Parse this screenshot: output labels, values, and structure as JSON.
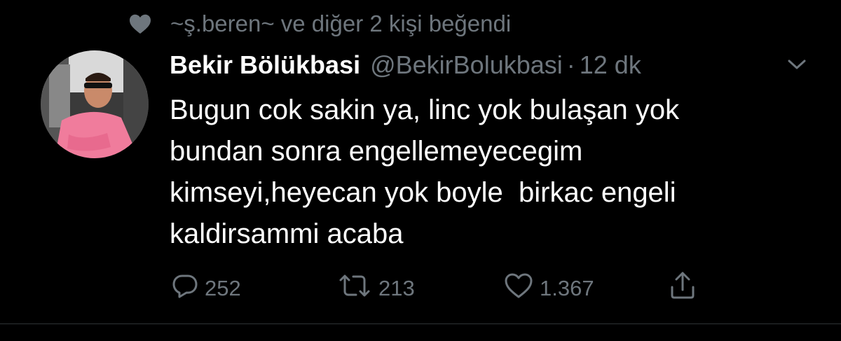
{
  "social_context": {
    "icon": "heart-icon",
    "text": "~ş.beren~ ve diğer 2 kişi beğendi"
  },
  "tweet": {
    "author": {
      "display_name": "Bekir Bölükbasi",
      "handle": "@BekirBolukbasi",
      "avatar": "avatar-photo"
    },
    "separator": "·",
    "time": "12 dk",
    "text_lines": [
      "Bugun cok sakin ya, linc yok bulaşan yok",
      "bundan sonra engellemeyecegim",
      "kimseyi,heyecan yok boyle  birkac engeli",
      "kaldirsammi acaba"
    ],
    "actions": {
      "reply": {
        "icon": "reply-icon",
        "count": "252"
      },
      "retweet": {
        "icon": "retweet-icon",
        "count": "213"
      },
      "like": {
        "icon": "like-icon",
        "count": "1.367"
      },
      "share": {
        "icon": "share-icon"
      }
    }
  },
  "colors": {
    "background": "#000000",
    "primary_text": "#ffffff",
    "secondary_text": "#6e767d",
    "divider": "#2f3336"
  }
}
